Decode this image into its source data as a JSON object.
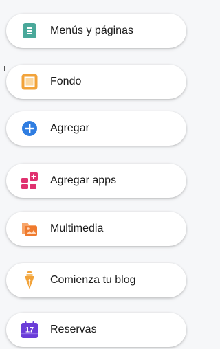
{
  "menu": {
    "items": [
      {
        "label": "Menús y páginas",
        "icon": "pages-icon",
        "color": "#4aa89a"
      },
      {
        "label": "Fondo",
        "icon": "background-icon",
        "color": "#f2a33a"
      },
      {
        "label": "Agregar",
        "icon": "add-icon",
        "color": "#2f7de1"
      },
      {
        "label": "Agregar apps",
        "icon": "apps-icon",
        "color": "#e0316f"
      },
      {
        "label": "Multimedia",
        "icon": "media-icon",
        "color": "#ef7a2e"
      },
      {
        "label": "Comienza tu blog",
        "icon": "blog-pen-icon",
        "color": "#f2a33a"
      },
      {
        "label": "Reservas",
        "icon": "bookings-calendar-icon",
        "color": "#6a3cd8"
      }
    ],
    "calendar_day": "17"
  }
}
